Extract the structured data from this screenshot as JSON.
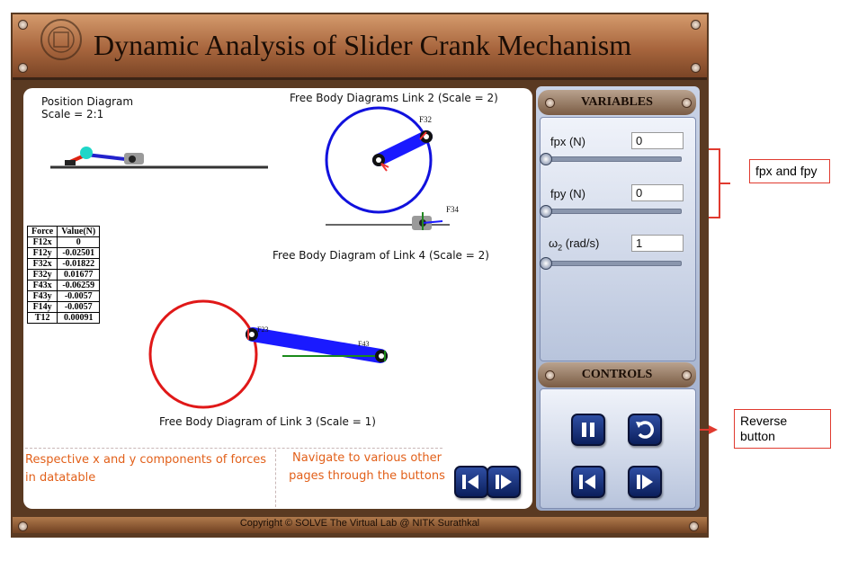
{
  "header": {
    "title": "Dynamic Analysis of Slider Crank Mechanism"
  },
  "position_diagram": {
    "title": "Position Diagram",
    "scale": "Scale = 2:1"
  },
  "fbd": {
    "link2": "Free Body Diagrams Link 2 (Scale = 2)",
    "link4": "Free Body Diagram of Link 4 (Scale = 2)",
    "link3": "Free Body Diagram of Link 3 (Scale = 1)",
    "labels": {
      "f32": "F32",
      "f34": "F34",
      "f23": "F23",
      "f43": "F43"
    }
  },
  "force_table": {
    "headers": [
      "Force",
      "Value(N)"
    ],
    "rows": [
      [
        "F12x",
        "0"
      ],
      [
        "F12y",
        "-0.02501"
      ],
      [
        "F32x",
        "-0.01822"
      ],
      [
        "F32y",
        "0.01677"
      ],
      [
        "F43x",
        "-0.06259"
      ],
      [
        "F43y",
        "-0.0057"
      ],
      [
        "F14y",
        "-0.0057"
      ],
      [
        "T12",
        "0.00091"
      ]
    ]
  },
  "notes": {
    "left": "Respective x and y components of forces in datatable",
    "right": "Navigate to various other pages through the buttons"
  },
  "variables": {
    "heading": "VARIABLES",
    "fpx": {
      "label": "fpx (N)",
      "value": "0",
      "slider": 0
    },
    "fpy": {
      "label": "fpy (N)",
      "value": "0",
      "slider": 0
    },
    "omega": {
      "label": "ω",
      "sub": "2",
      "unit": " (rad/s)",
      "value": "1",
      "slider": 0
    }
  },
  "controls": {
    "heading": "CONTROLS"
  },
  "footer": {
    "text": "Copyright © SOLVE The Virtual Lab @ NITK Surathkal"
  },
  "annotations": {
    "fpx_fpy": "fpx and fpy",
    "reverse": "Reverse button"
  },
  "colors": {
    "accent_red": "#e03a2f",
    "link_blue": "#1a1aff",
    "note_orange": "#e2601a"
  }
}
